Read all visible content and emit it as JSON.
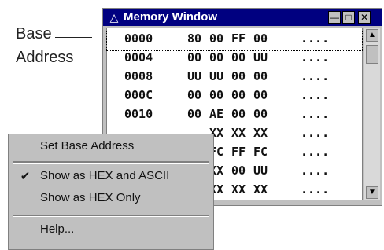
{
  "callout": {
    "line1": "Base",
    "line2": "Address"
  },
  "window": {
    "title": "Memory Window",
    "rows": [
      {
        "addr": "0000",
        "bytes": [
          "80",
          "00",
          "FF",
          "00"
        ],
        "ascii": "....",
        "selected": true
      },
      {
        "addr": "0004",
        "bytes": [
          "00",
          "00",
          "00",
          "UU"
        ],
        "ascii": "...."
      },
      {
        "addr": "0008",
        "bytes": [
          "UU",
          "UU",
          "00",
          "00"
        ],
        "ascii": "...."
      },
      {
        "addr": "000C",
        "bytes": [
          "00",
          "00",
          "00",
          "00"
        ],
        "ascii": "...."
      },
      {
        "addr": "0010",
        "bytes": [
          "00",
          "AE",
          "00",
          "00"
        ],
        "ascii": "...."
      },
      {
        "addr": "",
        "bytes": [
          "",
          "XX",
          "XX",
          "XX"
        ],
        "ascii": "...."
      },
      {
        "addr": "",
        "bytes": [
          "",
          "FC",
          "FF",
          "FC"
        ],
        "ascii": "...."
      },
      {
        "addr": "",
        "bytes": [
          "",
          "XX",
          "00",
          "UU"
        ],
        "ascii": "...."
      },
      {
        "addr": "",
        "bytes": [
          "",
          "XX",
          "XX",
          "XX"
        ],
        "ascii": "...."
      }
    ]
  },
  "menu": {
    "items": [
      {
        "label": "Set Base Address",
        "checked": false
      },
      {
        "label": "Show as HEX and ASCII",
        "checked": true
      },
      {
        "label": "Show as HEX Only",
        "checked": false
      },
      {
        "label": "Help...",
        "checked": false
      }
    ],
    "check_glyph": "✔"
  }
}
